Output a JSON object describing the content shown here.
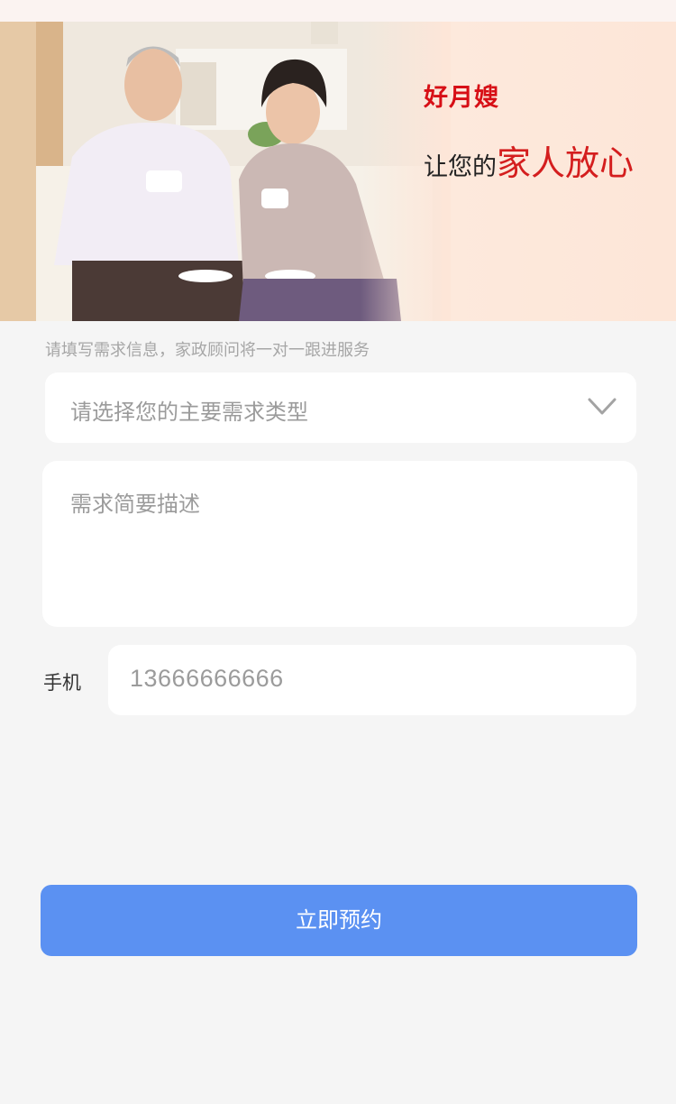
{
  "banner": {
    "brand": "好月嫂",
    "slogan_prefix": "让您的",
    "slogan_highlight": "家人放心",
    "photo_alt": "elderly-couple-photo"
  },
  "form": {
    "hint": "请填写需求信息，家政顾问将一对一跟进服务",
    "type_select_placeholder": "请选择您的主要需求类型",
    "description_placeholder": "需求简要描述",
    "phone_label": "手机",
    "phone_value": "13666666666",
    "submit_label": "立即预约"
  },
  "colors": {
    "brand_red": "#d70f16",
    "button_blue": "#5b91f2",
    "background": "#f5f5f5"
  }
}
